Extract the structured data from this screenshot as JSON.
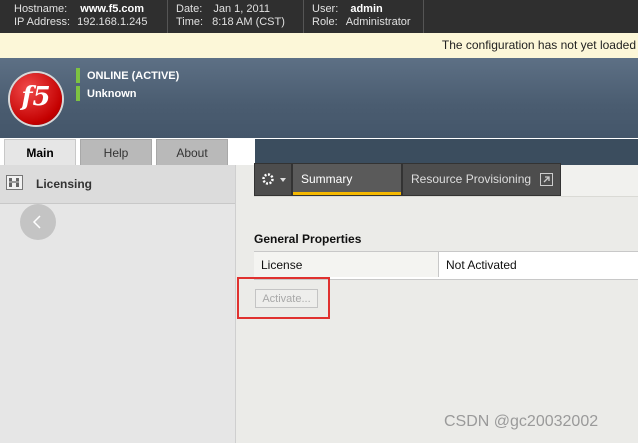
{
  "topbar": {
    "hostname_label": "Hostname:",
    "hostname_value": "www.f5.com",
    "ip_label": "IP Address:",
    "ip_value": "192.168.1.245",
    "date_label": "Date:",
    "date_value": "Jan 1, 2011",
    "time_label": "Time:",
    "time_value": "8:18 AM (CST)",
    "user_label": "User:",
    "user_value": "admin",
    "role_label": "Role:",
    "role_value": "Administrator"
  },
  "notice": {
    "text": "The configuration has not yet loaded"
  },
  "banner": {
    "logo_text": "f5",
    "status_1": "ONLINE (ACTIVE)",
    "status_2": "Unknown",
    "status_color": "#7dc242"
  },
  "nav_tabs": [
    {
      "label": "Main",
      "active": true
    },
    {
      "label": "Help",
      "active": false
    },
    {
      "label": "About",
      "active": false
    }
  ],
  "left_nav": {
    "items": [
      {
        "label": "Licensing",
        "icon": "licensing-icon"
      }
    ],
    "collapse_icon": "chevron-left-icon"
  },
  "content_tabs": {
    "gear_icon": "gear-icon",
    "items": [
      {
        "label": "Summary",
        "active": true
      },
      {
        "label": "Resource Provisioning",
        "active": false,
        "icon": "external-link-icon"
      }
    ],
    "accent_color": "#f5b800"
  },
  "properties": {
    "title": "General Properties",
    "rows": [
      {
        "label": "License",
        "value": "Not Activated"
      }
    ]
  },
  "actions": {
    "activate_label": "Activate...",
    "activate_enabled": false
  },
  "highlight_color": "#e0312f",
  "watermark": "CSDN @gc20032002"
}
